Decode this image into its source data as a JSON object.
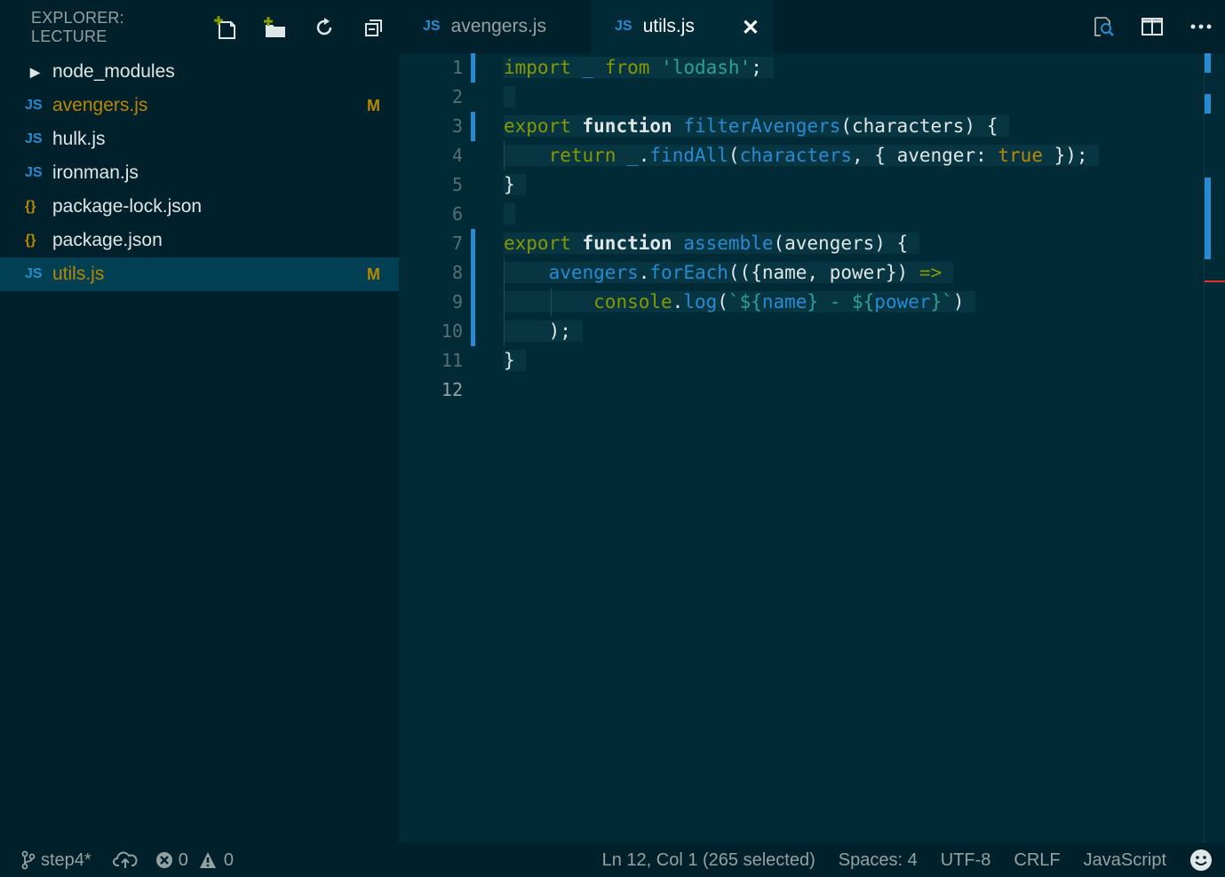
{
  "sidebar": {
    "title": "EXPLORER: LECTURE",
    "actions": [
      "new-file-icon",
      "new-folder-icon",
      "refresh-icon",
      "collapse-all-icon"
    ],
    "items": [
      {
        "type": "folder",
        "icon": "›",
        "label": "node_modules",
        "badge": ""
      },
      {
        "type": "js",
        "icon": "JS",
        "label": "avengers.js",
        "badge": "M"
      },
      {
        "type": "js",
        "icon": "JS",
        "label": "hulk.js",
        "badge": ""
      },
      {
        "type": "js",
        "icon": "JS",
        "label": "ironman.js",
        "badge": ""
      },
      {
        "type": "json",
        "icon": "{}",
        "label": "package-lock.json",
        "badge": ""
      },
      {
        "type": "json",
        "icon": "{}",
        "label": "package.json",
        "badge": ""
      },
      {
        "type": "js",
        "icon": "JS",
        "label": "utils.js",
        "badge": "M"
      }
    ]
  },
  "tabs": [
    {
      "icon": "JS",
      "label": "avengers.js"
    },
    {
      "icon": "JS",
      "label": "utils.js",
      "close": "✕"
    }
  ],
  "tab_actions": [
    "open-changes-icon",
    "split-editor-icon",
    "more-actions-icon"
  ],
  "editor": {
    "line_numbers": [
      "1",
      "2",
      "3",
      "4",
      "5",
      "6",
      "7",
      "8",
      "9",
      "10",
      "11",
      "12"
    ]
  },
  "statusbar": {
    "branch": "step4*",
    "errors": "0",
    "warnings": "0",
    "position": "Ln 12, Col 1 (265 selected)",
    "spaces": "Spaces: 4",
    "encoding": "UTF-8",
    "eol": "CRLF",
    "language": "JavaScript"
  },
  "colors": {
    "accent": "#268bd2",
    "keyword": "#859900",
    "string": "#2aa198",
    "modified": "#b58900",
    "background": "#002b36"
  }
}
